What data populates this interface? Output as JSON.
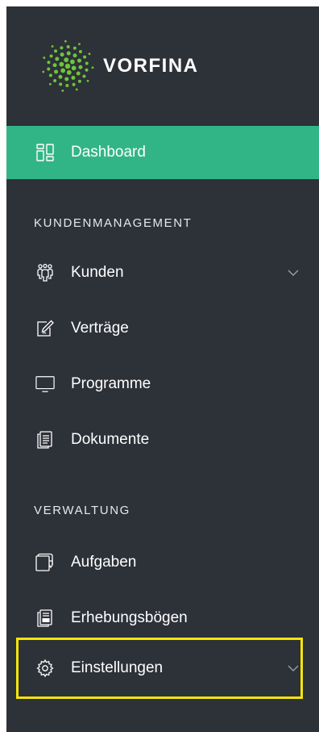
{
  "brand": {
    "name": "VORFINA",
    "accent_color": "#32b586",
    "logo_dot_color": "#6cc63a"
  },
  "nav": {
    "dashboard": {
      "label": "Dashboard",
      "icon": "dashboard-grid-icon",
      "active": true
    },
    "sections": [
      {
        "header": "KUNDENMANAGEMENT",
        "items": [
          {
            "label": "Kunden",
            "icon": "users-group-icon",
            "expandable": true
          },
          {
            "label": "Verträge",
            "icon": "edit-document-icon"
          },
          {
            "label": "Programme",
            "icon": "monitor-icon"
          },
          {
            "label": "Dokumente",
            "icon": "documents-icon"
          }
        ]
      },
      {
        "header": "VERWALTUNG",
        "items": [
          {
            "label": "Aufgaben",
            "icon": "tasks-icon"
          },
          {
            "label": "Erhebungsbögen",
            "icon": "pdf-document-icon"
          },
          {
            "label": "Einstellungen",
            "icon": "gear-icon",
            "expandable": true,
            "highlighted": true
          }
        ]
      }
    ]
  },
  "colors": {
    "sidebar_bg": "#2d3138",
    "highlight_border": "#f5e50c"
  }
}
